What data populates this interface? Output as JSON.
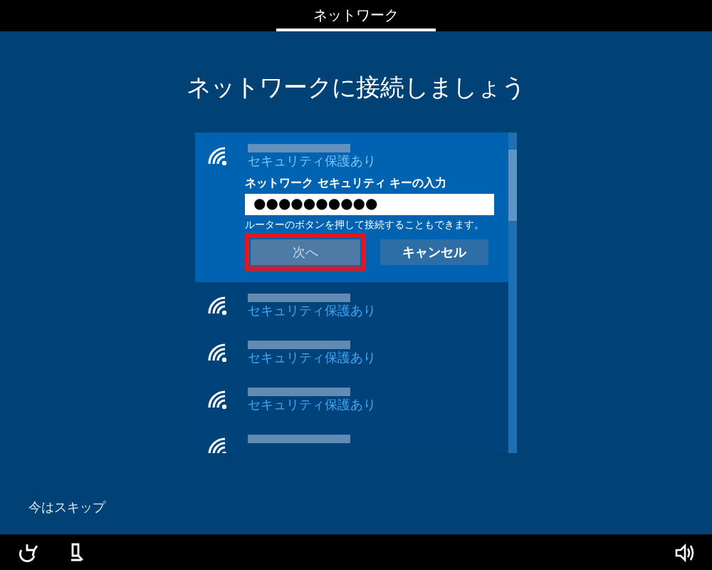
{
  "top_bar": {
    "title": "ネットワーク"
  },
  "heading": "ネットワークに接続しましょう",
  "networks": [
    {
      "security": "セキュリティ保護あり",
      "selected": true,
      "expanded": true,
      "key_label": "ネットワーク セキュリティ キーの入力",
      "key_value": "●●●●●●●●●●",
      "hint": "ルーターのボタンを押して接続することもできます。",
      "buttons": [
        {
          "label": "次へ",
          "highlighted": true
        },
        {
          "label": "キャンセル",
          "highlighted": false
        }
      ]
    },
    {
      "security": "セキュリティ保護あり",
      "selected": false,
      "expanded": false
    },
    {
      "security": "セキュリティ保護あり",
      "selected": false,
      "expanded": false
    },
    {
      "security": "セキュリティ保護あり",
      "selected": false,
      "expanded": false
    },
    {
      "selected": false,
      "expanded": false
    }
  ],
  "skip_link": "今はスキップ"
}
